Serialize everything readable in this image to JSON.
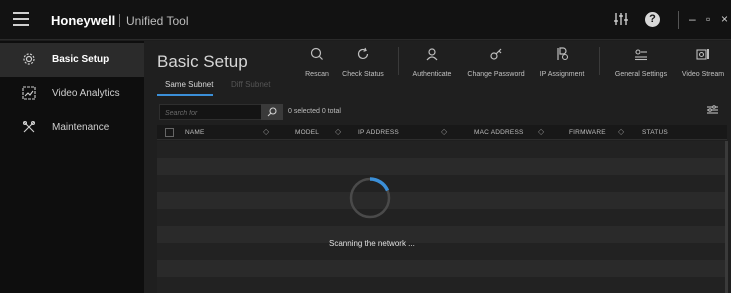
{
  "titlebar": {
    "brand": "Honeywell",
    "app_title": "Unified Tool",
    "icons": [
      "menu-icon",
      "sliders-icon",
      "help-icon",
      "minimize-icon",
      "maximize-icon",
      "close-icon"
    ],
    "help_glyph": "?"
  },
  "sidebar": {
    "items": [
      {
        "label": "Basic Setup",
        "icon": "gear-icon",
        "active": true
      },
      {
        "label": "Video Analytics",
        "icon": "analytics-icon",
        "active": false
      },
      {
        "label": "Maintenance",
        "icon": "tools-icon",
        "active": false
      }
    ]
  },
  "main": {
    "page_title": "Basic Setup",
    "toolbar": [
      {
        "label": "Rescan",
        "icon": "rescan-icon"
      },
      {
        "label": "Check Status",
        "icon": "refresh-icon"
      },
      {
        "label": "Authenticate",
        "icon": "user-icon"
      },
      {
        "label": "Change Password",
        "icon": "key-icon"
      },
      {
        "label": "IP Assignment",
        "icon": "ip-assign-icon"
      },
      {
        "label": "General Settings",
        "icon": "settings-icon"
      },
      {
        "label": "Video Stream",
        "icon": "video-icon"
      }
    ],
    "tabs": [
      {
        "label": "Same Subnet",
        "active": true
      },
      {
        "label": "Diff Subnet",
        "active": false
      }
    ],
    "search": {
      "placeholder": "Search for",
      "value": ""
    },
    "selection": {
      "selected": "0 selected",
      "total": "0 total"
    },
    "table": {
      "columns": [
        "NAME",
        "MODEL",
        "IP ADDRESS",
        "MAC ADDRESS",
        "FIRMWARE",
        "STATUS"
      ],
      "rows": []
    },
    "status_text": "Scanning the network ...",
    "accent_color": "#3b8fd8"
  }
}
